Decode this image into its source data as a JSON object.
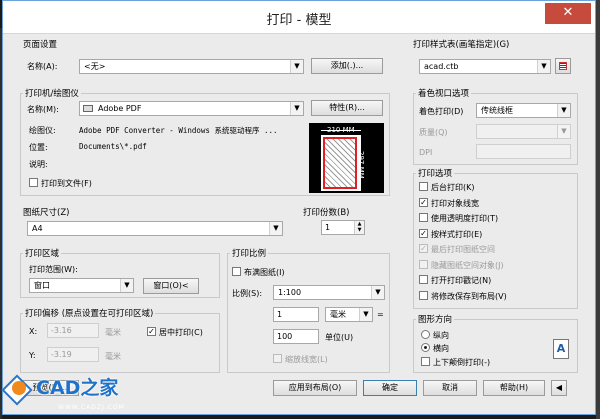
{
  "window": {
    "title": "打印 - 模型",
    "close_icon": "✕"
  },
  "page_setup": {
    "group_title": "页面设置",
    "name_label": "名称(A):",
    "name_value": "<无>",
    "add_button": "添加(.)..."
  },
  "printer": {
    "group_title": "打印机/绘图仪",
    "name_label": "名称(M):",
    "name_value": "Adobe PDF",
    "properties_button": "特性(R)...",
    "plotter_label": "绘图仪:",
    "plotter_value": "Adobe PDF Converter - Windows 系统驱动程序 ...",
    "location_label": "位置:",
    "location_value": "Documents\\*.pdf",
    "description_label": "说明:",
    "print_to_file_label": "打印到文件(F)",
    "print_to_file_checked": false,
    "preview_width": "210 MM",
    "preview_height": "297 MM"
  },
  "paper_size": {
    "group_title": "图纸尺寸(Z)",
    "value": "A4"
  },
  "copies": {
    "group_title": "打印份数(B)",
    "value": "1"
  },
  "plot_area": {
    "group_title": "打印区域",
    "range_label": "打印范围(W):",
    "range_value": "窗口",
    "window_button": "窗口(O)<"
  },
  "plot_offset": {
    "group_title": "打印偏移 (原点设置在可打印区域)",
    "x_label": "X:",
    "x_value": "-3.16",
    "x_unit": "毫米",
    "y_label": "Y:",
    "y_value": "-3.19",
    "y_unit": "毫米",
    "center_label": "居中打印(C)",
    "center_checked": true
  },
  "plot_scale": {
    "group_title": "打印比例",
    "fit_label": "布满图纸(I)",
    "fit_checked": false,
    "scale_label": "比例(S):",
    "scale_value": "1:100",
    "value1": "1",
    "unit1": "毫米",
    "equals": "=",
    "value2": "100",
    "unit2": "单位(U)",
    "lineweight_label": "缩放线宽(L)",
    "lineweight_checked": false
  },
  "style_table": {
    "group_title": "打印样式表(画笔指定)(G)",
    "value": "acad.ctb",
    "edit_icon": "edit-icon"
  },
  "shaded_viewport": {
    "group_title": "着色视口选项",
    "shade_label": "着色打印(D)",
    "shade_value": "传统线框",
    "quality_label": "质量(Q)",
    "quality_value": "",
    "dpi_label": "DPI",
    "dpi_value": ""
  },
  "plot_options": {
    "group_title": "打印选项",
    "items": [
      {
        "label": "后台打印(K)",
        "checked": false,
        "disabled": false
      },
      {
        "label": "打印对象线宽",
        "checked": true,
        "disabled": false
      },
      {
        "label": "使用透明度打印(T)",
        "checked": false,
        "disabled": false
      },
      {
        "label": "按样式打印(E)",
        "checked": true,
        "disabled": false
      },
      {
        "label": "最后打印图纸空间",
        "checked": true,
        "disabled": true
      },
      {
        "label": "隐藏图纸空间对象(J)",
        "checked": false,
        "disabled": true
      },
      {
        "label": "打开打印戳记(N)",
        "checked": false,
        "disabled": false
      },
      {
        "label": "将修改保存到布局(V)",
        "checked": false,
        "disabled": false
      }
    ]
  },
  "orientation": {
    "group_title": "图形方向",
    "portrait_label": "纵向",
    "landscape_label": "横向",
    "upside_down_label": "上下颠倒打印(-)",
    "selected": "landscape",
    "icon_letter": "A"
  },
  "footer": {
    "preview_button": "预览(P)...",
    "apply_button": "应用到布局(O)",
    "ok_button": "确定",
    "cancel_button": "取消",
    "help_button": "帮助(H)"
  },
  "watermark": {
    "brand": "CAD之家",
    "url": "WWW.CADZJ.COM"
  }
}
